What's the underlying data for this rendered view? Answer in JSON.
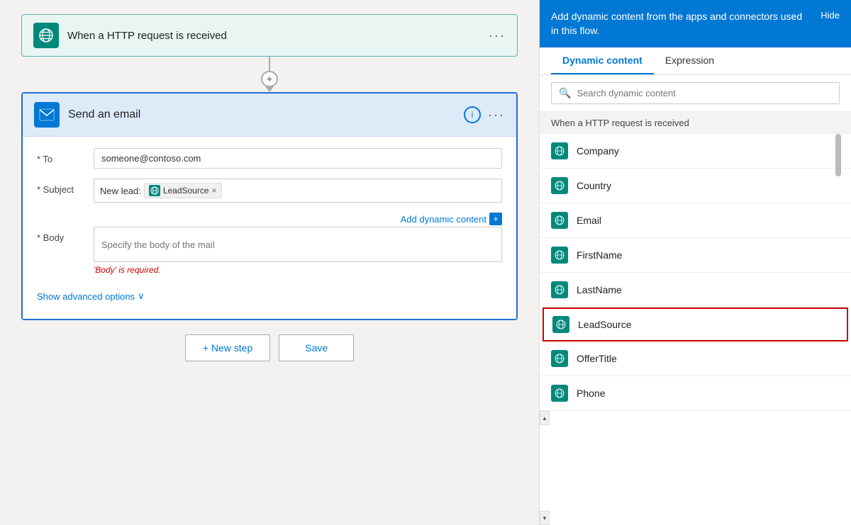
{
  "http_card": {
    "title": "When a HTTP request is received",
    "icon": "🌐",
    "more_label": "···"
  },
  "connector": {
    "plus_label": "+"
  },
  "email_card": {
    "title": "Send an email",
    "icon": "O",
    "more_label": "···",
    "info_label": "i"
  },
  "form": {
    "to_label": "* To",
    "to_value": "someone@contoso.com",
    "to_placeholder": "someone@contoso.com",
    "subject_label": "* Subject",
    "subject_prefix": "New lead: ",
    "subject_tag": "LeadSource",
    "subject_tag_remove": "×",
    "add_dynamic_label": "Add dynamic content",
    "body_label": "* Body",
    "body_placeholder": "Specify the body of the mail",
    "body_error": "'Body' is required.",
    "show_advanced_label": "Show advanced options",
    "chevron": "∨"
  },
  "buttons": {
    "new_step_label": "+ New step",
    "save_label": "Save"
  },
  "dynamic_panel": {
    "header_text": "Add dynamic content from the apps and connectors used in this flow.",
    "hide_label": "Hide",
    "tab_dynamic": "Dynamic content",
    "tab_expression": "Expression",
    "search_placeholder": "Search dynamic content",
    "section_header": "When a HTTP request is received",
    "items": [
      {
        "label": "Company",
        "icon": "⚙"
      },
      {
        "label": "Country",
        "icon": "⚙"
      },
      {
        "label": "Email",
        "icon": "⚙"
      },
      {
        "label": "FirstName",
        "icon": "⚙"
      },
      {
        "label": "LastName",
        "icon": "⚙"
      },
      {
        "label": "LeadSource",
        "icon": "⚙",
        "highlighted": true
      },
      {
        "label": "OfferTitle",
        "icon": "⚙"
      },
      {
        "label": "Phone",
        "icon": "⚙"
      }
    ]
  }
}
